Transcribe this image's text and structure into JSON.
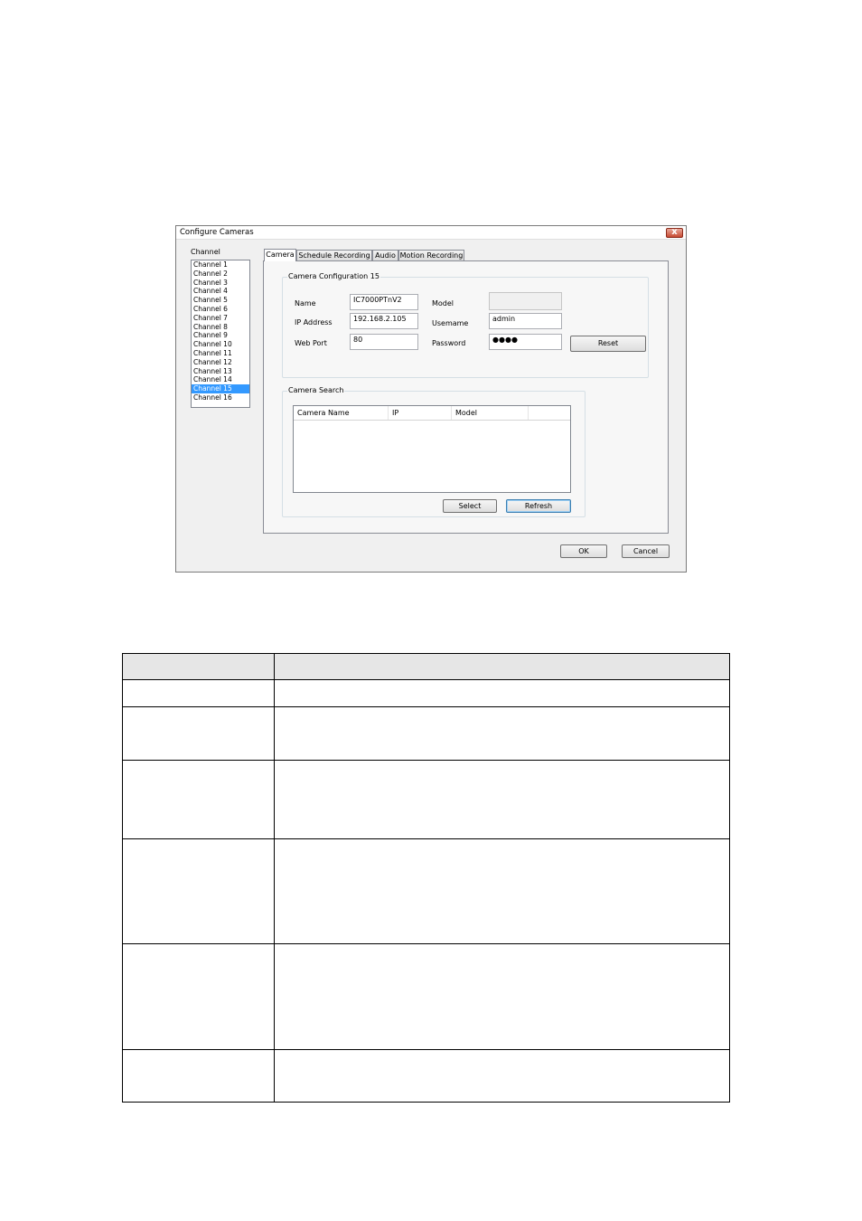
{
  "dialog": {
    "title": "Configure Cameras",
    "close_glyph": "x",
    "channel_label": "Channel",
    "channels": [
      "Channel 1",
      "Channel 2",
      "Channel 3",
      "Channel 4",
      "Channel 5",
      "Channel 6",
      "Channel 7",
      "Channel 8",
      "Channel 9",
      "Channel 10",
      "Channel 11",
      "Channel 12",
      "Channel 13",
      "Channel 14",
      "Channel 15",
      "Channel 16"
    ],
    "selected_channel": "Channel 15",
    "tabs": {
      "camera": "Camera",
      "schedule": "Schedule Recording",
      "audio": "Audio",
      "motion": "Motion Recording"
    },
    "active_tab": "Camera",
    "config": {
      "title": "Camera Configuration 15",
      "name_label": "Name",
      "name_value": "IC7000PTnV2",
      "ip_label": "IP Address",
      "ip_value": "192.168.2.105",
      "port_label": "Web Port",
      "port_value": "80",
      "model_label": "Model",
      "model_value": "",
      "username_label": "Usemame",
      "username_value": "admin",
      "password_label": "Password",
      "password_value": "●●●●",
      "reset_label": "Reset"
    },
    "search": {
      "title": "Camera Search",
      "columns": {
        "name": "Camera Name",
        "ip": "IP",
        "model": "Model"
      },
      "select_label": "Select",
      "refresh_label": "Refresh"
    },
    "ok_label": "OK",
    "cancel_label": "Cancel"
  }
}
